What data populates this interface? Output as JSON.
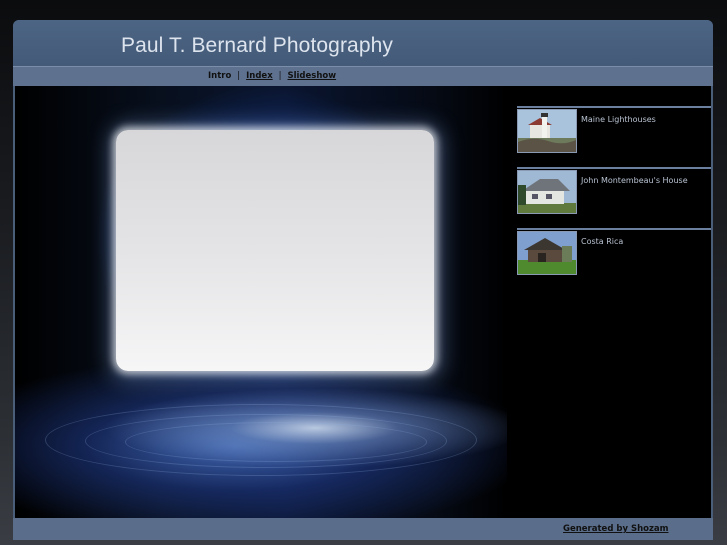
{
  "header": {
    "title": "Paul T. Bernard Photography"
  },
  "nav": {
    "items": [
      {
        "label": "Intro",
        "link": false
      },
      {
        "label": "Index",
        "link": true
      },
      {
        "label": "Slideshow",
        "link": true
      }
    ],
    "separator": "|"
  },
  "gallery": {
    "items": [
      {
        "label": "Maine Lighthouses",
        "thumb_icon": "lighthouse-thumbnail"
      },
      {
        "label": "John Montembeau's House",
        "thumb_icon": "house-thumbnail"
      },
      {
        "label": "Costa Rica",
        "thumb_icon": "barn-thumbnail"
      }
    ]
  },
  "footer": {
    "credit": "Generated by Shozam"
  },
  "colors": {
    "frame": "#4a5e7a",
    "navbar": "#5e7290",
    "footer": "#5a6d8a",
    "title_text": "#dde4ee",
    "gallery_text": "#b9c3d2"
  }
}
